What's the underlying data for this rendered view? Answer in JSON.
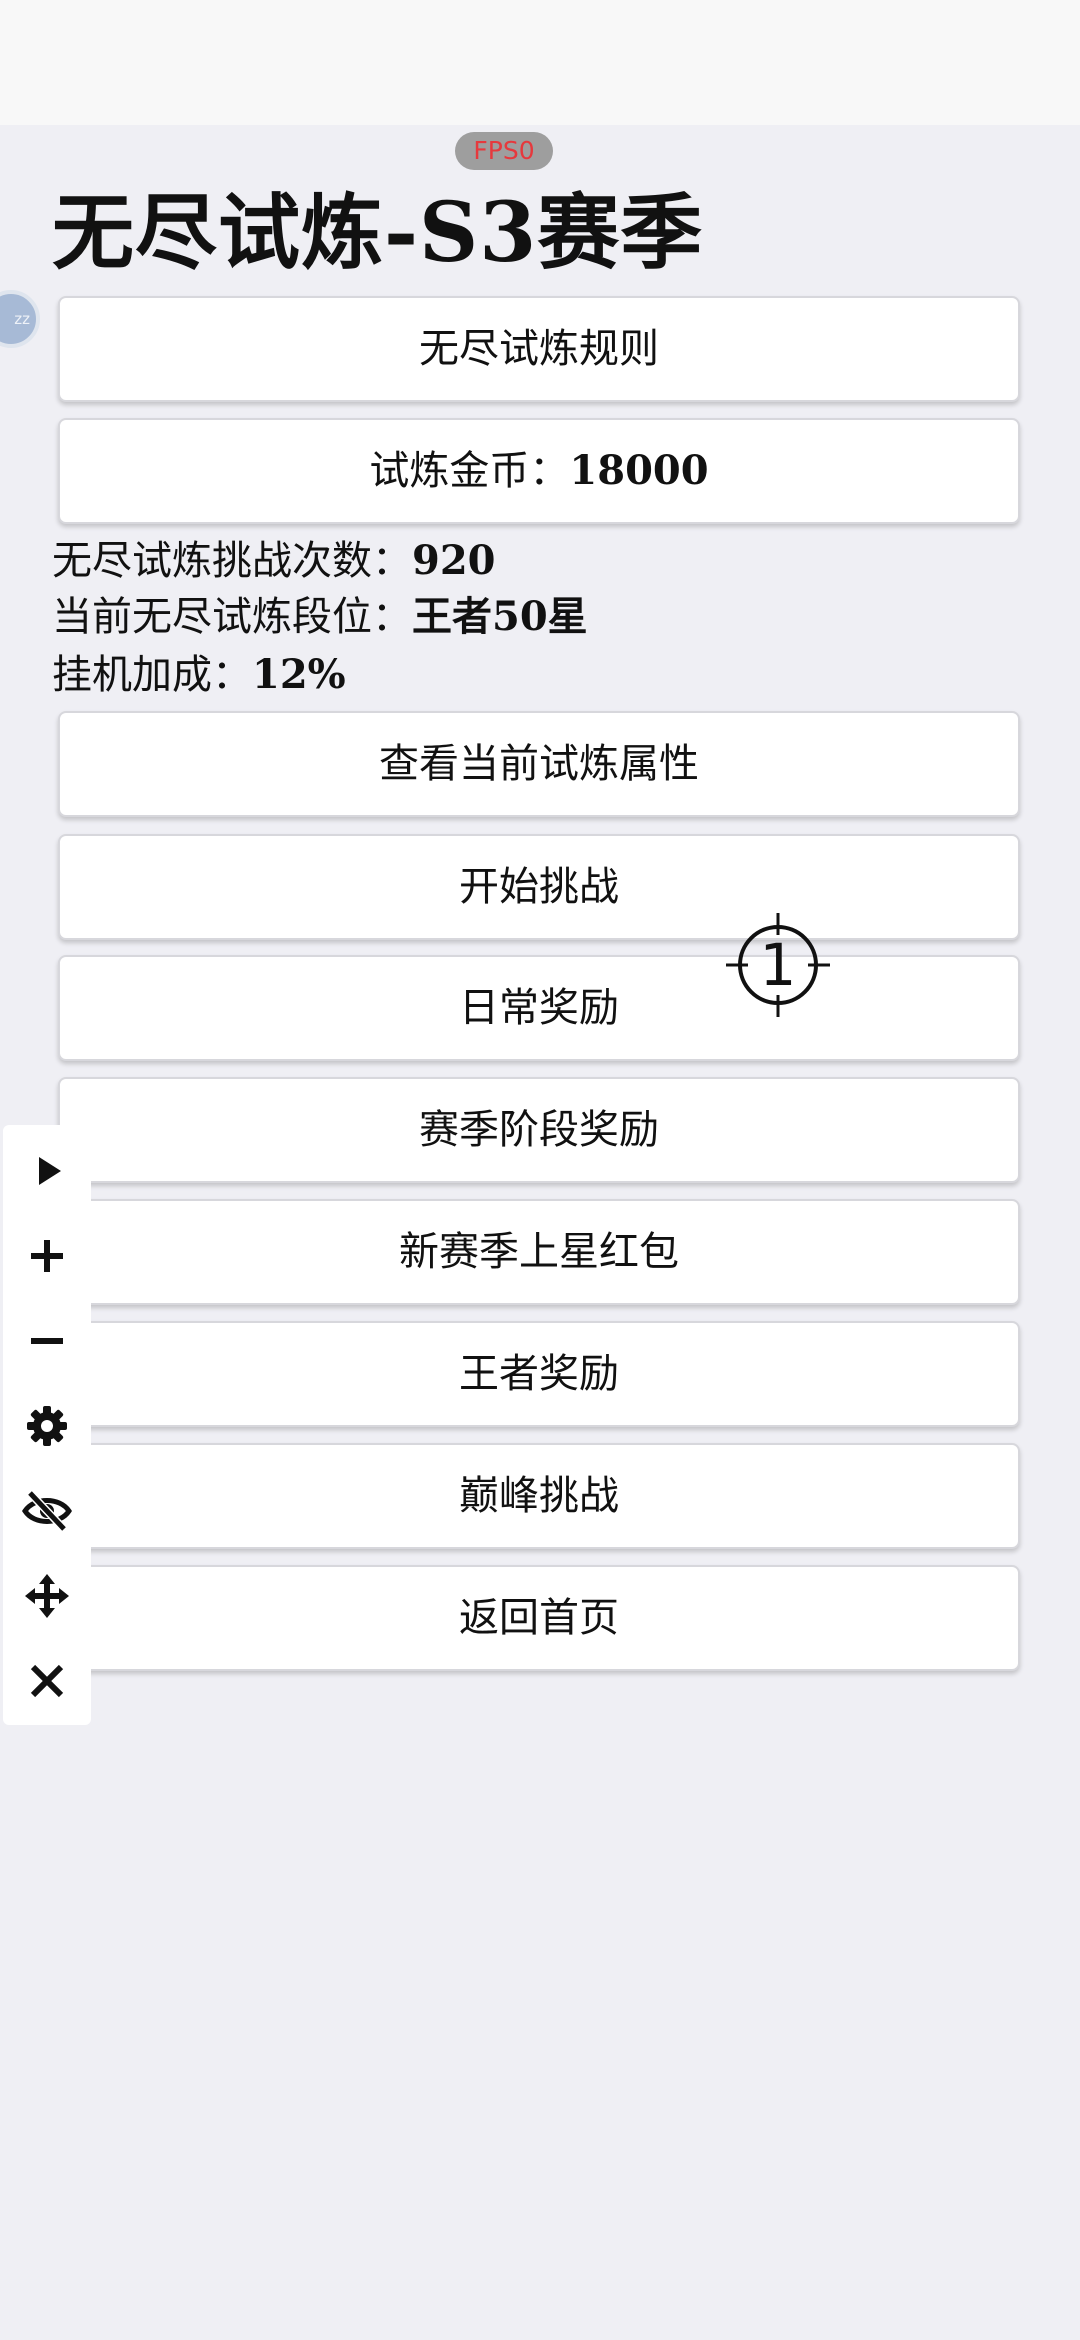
{
  "fps_label": "FPS0",
  "title": "无尽试炼-S3赛季",
  "avatar_text": "zz",
  "rules_button": "无尽试炼规则",
  "coins": {
    "label": "试炼金币：",
    "value": "18000"
  },
  "stats": [
    {
      "label": "无尽试炼挑战次数：",
      "value": "920"
    },
    {
      "label": "当前无尽试炼段位：",
      "value": "王者50星"
    },
    {
      "label": "挂机加成：",
      "value": "12%"
    }
  ],
  "menu": [
    "查看当前试炼属性",
    "开始挑战",
    "日常奖励",
    "赛季阶段奖励",
    "新赛季上星红包",
    "王者奖励",
    "巅峰挑战",
    "返回首页"
  ],
  "toolbar": {
    "icons": [
      "play-icon",
      "plus-icon",
      "minus-icon",
      "gear-icon",
      "eye-off-icon",
      "move-icon",
      "close-icon"
    ]
  },
  "crosshair_label": "1",
  "colors": {
    "background": "#efeff4",
    "fps_text": "#e6393d",
    "button_bg": "#ffffff"
  }
}
